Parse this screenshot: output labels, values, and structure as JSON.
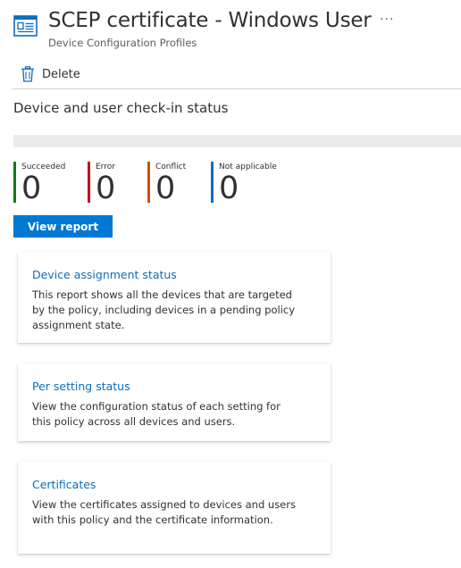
{
  "header": {
    "title": "SCEP certificate - Windows User",
    "subtitle": "Device Configuration Profiles",
    "more_label": "···",
    "page_icon": "profile-window-icon"
  },
  "toolbar": {
    "delete_label": "Delete",
    "delete_icon": "trash-icon"
  },
  "status": {
    "section_title": "Device and user check-in status",
    "progress_fraction": 0,
    "stats": [
      {
        "label": "Succeeded",
        "value": "0",
        "color": "#107c10"
      },
      {
        "label": "Error",
        "value": "0",
        "color": "#c50f1f"
      },
      {
        "label": "Conflict",
        "value": "0",
        "color": "#ca5010"
      },
      {
        "label": "Not applicable",
        "value": "0",
        "color": "#0f6cbd"
      }
    ],
    "view_report_label": "View report"
  },
  "cards": [
    {
      "title": "Device assignment status",
      "description": "This report shows all the devices that are targeted by the policy, including devices in a pending policy assignment state."
    },
    {
      "title": "Per setting status",
      "description": "View the configuration status of each setting for this policy across all devices and users."
    },
    {
      "title": "Certificates",
      "description": "View the certificates assigned to devices and users with this policy and the certificate information."
    }
  ]
}
